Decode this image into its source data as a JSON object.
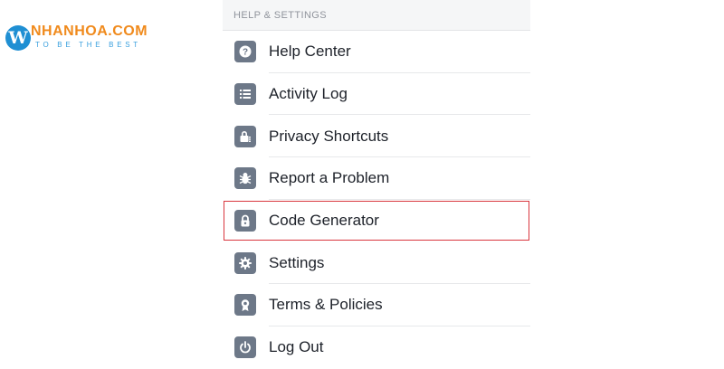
{
  "watermark": {
    "mark": "W",
    "brand": "NHANHOA.COM",
    "tagline": "TO BE THE BEST"
  },
  "section": {
    "header": "HELP & SETTINGS"
  },
  "menu": {
    "items": [
      {
        "label": "Help Center",
        "icon": "help-icon"
      },
      {
        "label": "Activity Log",
        "icon": "list-icon"
      },
      {
        "label": "Privacy Shortcuts",
        "icon": "privacy-lock-icon"
      },
      {
        "label": "Report a Problem",
        "icon": "bug-icon"
      },
      {
        "label": "Code Generator",
        "icon": "padlock-icon",
        "highlighted": true
      },
      {
        "label": "Settings",
        "icon": "gear-icon"
      },
      {
        "label": "Terms & Policies",
        "icon": "badge-icon"
      },
      {
        "label": "Log Out",
        "icon": "power-icon"
      }
    ]
  },
  "colors": {
    "icon_bg": "#6d7888",
    "highlight_border": "#d9363e",
    "text": "#1d2129",
    "header_text": "#90949c",
    "brand_orange": "#f08a1c",
    "brand_blue": "#1f8fd3"
  }
}
